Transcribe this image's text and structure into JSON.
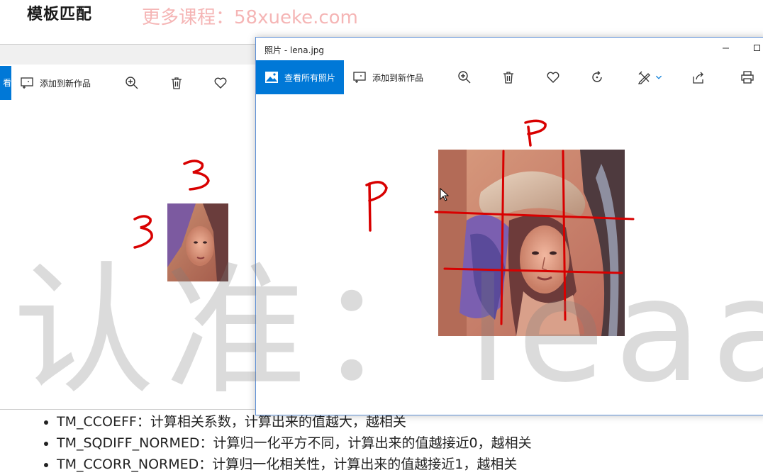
{
  "page": {
    "heading": "模板匹配",
    "site_watermark": "更多课程：58xueke.com",
    "big_watermark": "认准：leaaiv"
  },
  "back_window": {
    "view_all_label": "看",
    "toolbar": {
      "add_to_creation": "添加到新作品"
    },
    "annotations": {
      "top": "3",
      "left": "3"
    }
  },
  "front_window": {
    "title": "照片 - lena.jpg",
    "toolbar": {
      "view_all": "查看所有照片",
      "add_to_creation": "添加到新作品"
    },
    "annotations": {
      "top": "P",
      "left": "P"
    }
  },
  "icons": [
    "picture-icon",
    "add-creation-icon",
    "zoom-icon",
    "delete-icon",
    "heart-icon",
    "rotate-icon",
    "edit-icon",
    "chevron-down-icon",
    "share-icon",
    "print-icon",
    "minimize-icon",
    "maximize-icon"
  ],
  "colors": {
    "accent": "#0078d7",
    "annotation": "#d80000",
    "watermark": "#e85a5a"
  },
  "bullets": [
    "TM_CCOEFF：计算相关系数，计算出来的值越大，越相关",
    "TM_SQDIFF_NORMED：计算归一化平方不同，计算出来的值越接近0，越相关",
    "TM_CCORR_NORMED：计算归一化相关性，计算出来的值越接近1，越相关"
  ]
}
